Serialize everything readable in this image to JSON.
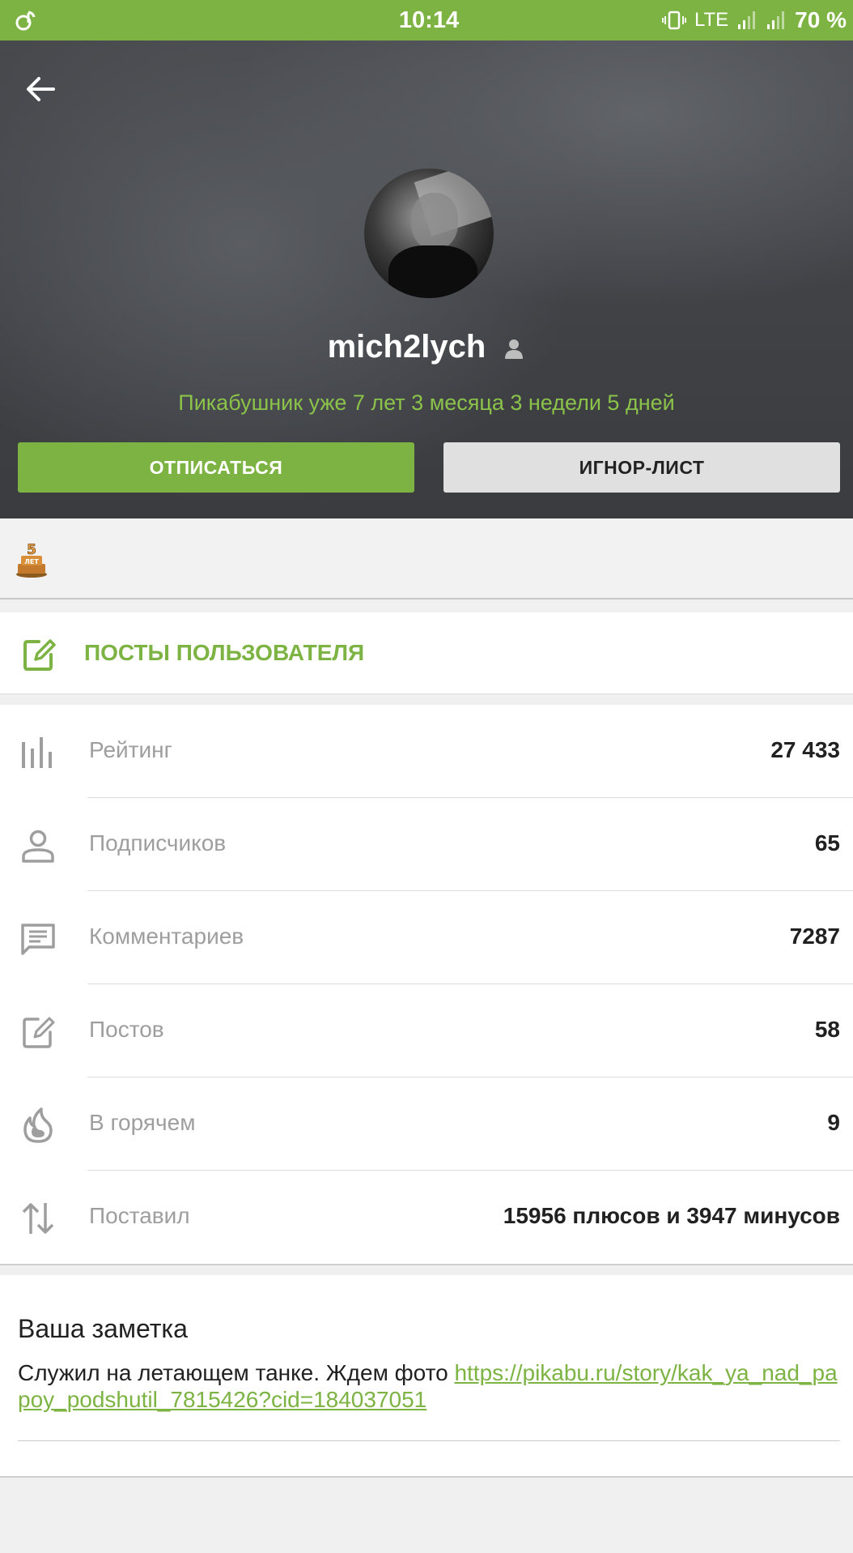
{
  "status_bar": {
    "time": "10:14",
    "network": "LTE",
    "battery": "70 %"
  },
  "profile": {
    "username": "mich2lych",
    "tenure": "Пикабушник уже 7 лет 3 месяца 3 недели 5 дней",
    "unsubscribe_label": "ОТПИСАТЬСЯ",
    "ignore_label": "ИГНОР-ЛИСТ"
  },
  "awards": [
    {
      "icon": "five-years-award-icon",
      "text": "5 ЛЕТ"
    }
  ],
  "posts_link": {
    "label": "ПОСТЫ ПОЛЬЗОВАТЕЛЯ"
  },
  "stats": [
    {
      "icon": "rating-bars-icon",
      "label": "Рейтинг",
      "value": "27 433"
    },
    {
      "icon": "person-icon",
      "label": "Подписчиков",
      "value": "65"
    },
    {
      "icon": "comment-icon",
      "label": "Комментариев",
      "value": "7287"
    },
    {
      "icon": "edit-icon",
      "label": "Постов",
      "value": "58"
    },
    {
      "icon": "flame-icon",
      "label": "В горячем",
      "value": "9"
    },
    {
      "icon": "sort-arrows-icon",
      "label": "Поставил",
      "value": "15956 плюсов и 3947 минусов"
    }
  ],
  "note": {
    "title": "Ваша заметка",
    "text": "Служил на летающем танке. Ждем фото ",
    "link": "https://pikabu.ru/story/kak_ya_nad_papoy_podshutil_7815426?cid=184037051"
  },
  "colors": {
    "accent": "#7cb342",
    "accent_text": "#8bc34a",
    "header_bg": "#3f4145"
  }
}
